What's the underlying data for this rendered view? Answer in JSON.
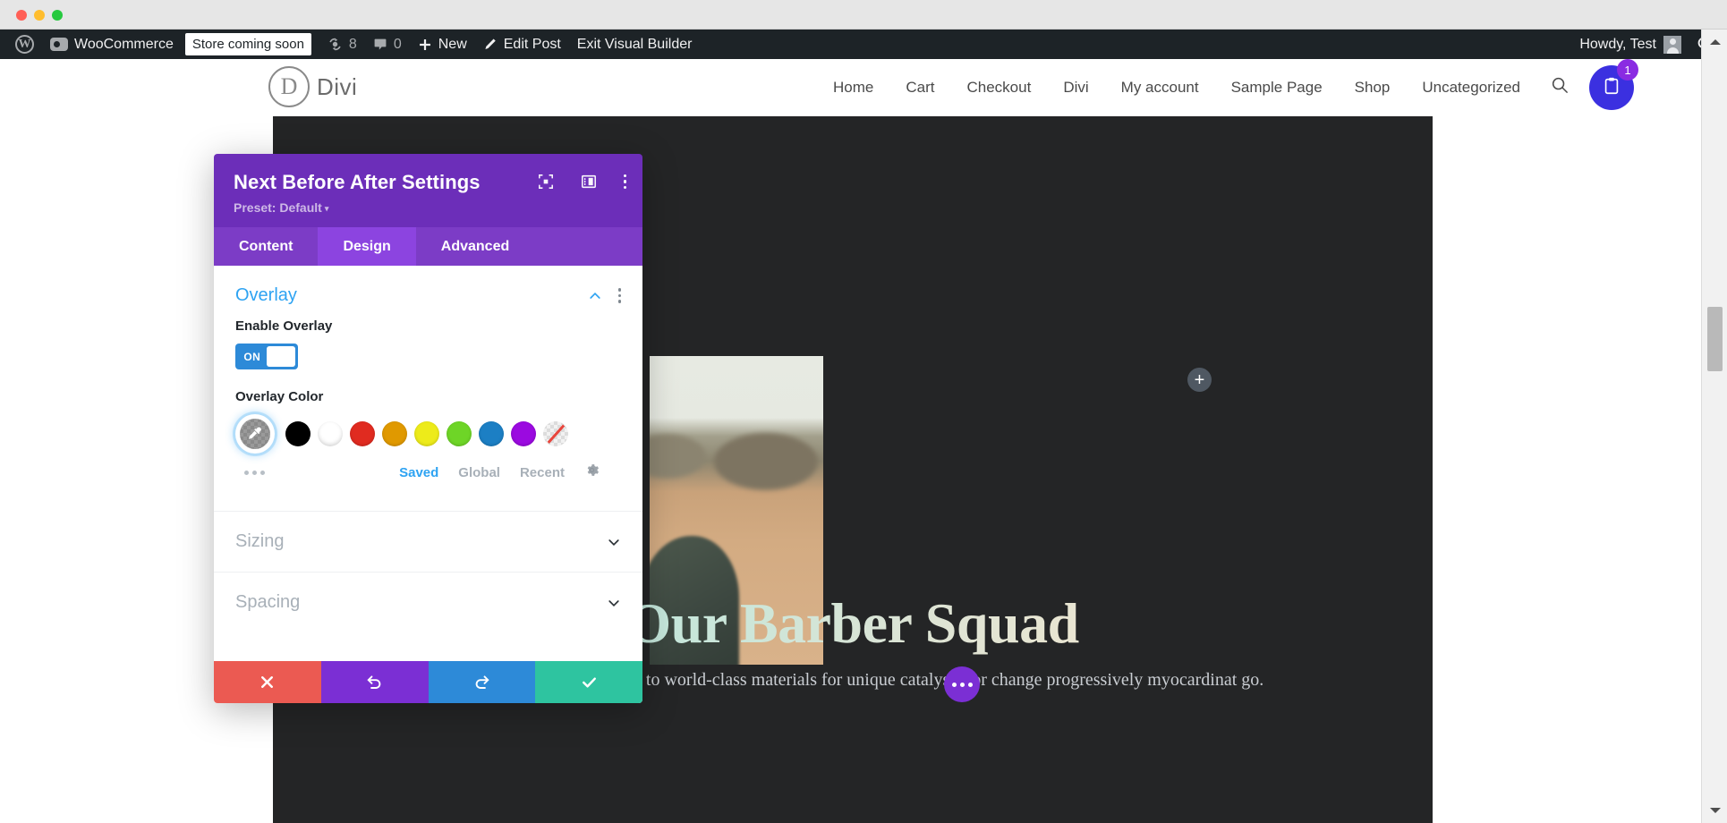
{
  "window": {
    "traffic_lights": [
      "close",
      "minimize",
      "maximize"
    ]
  },
  "adminbar": {
    "wp_logo": "wordpress-logo-icon",
    "wp_logo_letter": "W",
    "items": [
      {
        "id": "woocommerce",
        "label": "WooCommerce",
        "icon": "woocommerce-icon"
      },
      {
        "id": "store-status",
        "label": "Store coming soon"
      },
      {
        "id": "updates",
        "label": "8",
        "icon": "updates-icon"
      },
      {
        "id": "comments",
        "label": "0",
        "icon": "comment-bubble-icon"
      },
      {
        "id": "new",
        "label": "New",
        "icon": "plus-icon"
      },
      {
        "id": "edit-post",
        "label": "Edit Post",
        "icon": "pencil-icon"
      },
      {
        "id": "exit-visual-builder",
        "label": "Exit Visual Builder"
      }
    ],
    "howdy": "Howdy, Test",
    "search_icon": "search-icon"
  },
  "site": {
    "logo_letter": "D",
    "logo_word": "Divi",
    "nav": [
      "Home",
      "Cart",
      "Checkout",
      "Divi",
      "My account",
      "Sample Page",
      "Shop",
      "Uncategorized"
    ],
    "search_icon": "search-icon",
    "cart_icon": "cart-clipboard-icon",
    "cart_count": "1",
    "cart_color": "#3b30e0",
    "cart_badge_color": "#8a2be2"
  },
  "canvas": {
    "add_module_label": "+",
    "hero_title": "Our Barber Squad",
    "hero_body": "Interactively provide access to world-class materials for unique catalysts for change progressively myocardinat go.",
    "three_dot_label": "module-options",
    "background": "#242526",
    "title_gradient_from": "#9fe4da",
    "title_gradient_to": "#f6ead4"
  },
  "modal": {
    "title": "Next Before After Settings",
    "preset_label": "Preset: Default",
    "header_color": "#6c2eb9",
    "header_icons": [
      {
        "id": "expand",
        "name": "expand-view-icon"
      },
      {
        "id": "layout",
        "name": "panel-layout-icon"
      },
      {
        "id": "more",
        "name": "kebab-menu-icon"
      }
    ],
    "tabs": [
      {
        "label": "Content",
        "active": false
      },
      {
        "label": "Design",
        "active": true
      },
      {
        "label": "Advanced",
        "active": false
      }
    ],
    "sections": [
      {
        "id": "overlay",
        "label": "Overlay",
        "expanded": true
      },
      {
        "id": "sizing",
        "label": "Sizing",
        "expanded": false
      },
      {
        "id": "spacing",
        "label": "Spacing",
        "expanded": false
      }
    ],
    "overlay": {
      "enable_label": "Enable Overlay",
      "enable_value": "ON",
      "color_label": "Overlay Color",
      "picker_name": "eyedropper-icon",
      "swatches": [
        {
          "name": "black",
          "hex": "#000000"
        },
        {
          "name": "white",
          "hex": "#ffffff"
        },
        {
          "name": "red",
          "hex": "#e02b20"
        },
        {
          "name": "orange",
          "hex": "#e09900"
        },
        {
          "name": "yellow",
          "hex": "#edeb1a"
        },
        {
          "name": "green",
          "hex": "#6ed527"
        },
        {
          "name": "blue",
          "hex": "#1c7fc4"
        },
        {
          "name": "purple",
          "hex": "#9b0ae0"
        },
        {
          "name": "none",
          "hex": "transparent"
        }
      ],
      "more_colors": "more-colors-icon",
      "palette_tabs": [
        {
          "label": "Saved",
          "active": true
        },
        {
          "label": "Global",
          "active": false
        },
        {
          "label": "Recent",
          "active": false
        }
      ],
      "settings_icon": "gear-icon"
    },
    "footer": [
      {
        "id": "cancel",
        "name": "close-icon",
        "color": "#eb5a52"
      },
      {
        "id": "undo",
        "name": "undo-icon",
        "color": "#7b2fd4"
      },
      {
        "id": "redo",
        "name": "redo-icon",
        "color": "#2d8ad8"
      },
      {
        "id": "save",
        "name": "check-icon",
        "color": "#2ec4a0"
      }
    ]
  },
  "scrollbar": {
    "up_arrow": "scroll-up-arrow-icon",
    "down_arrow": "scroll-down-arrow-icon"
  }
}
